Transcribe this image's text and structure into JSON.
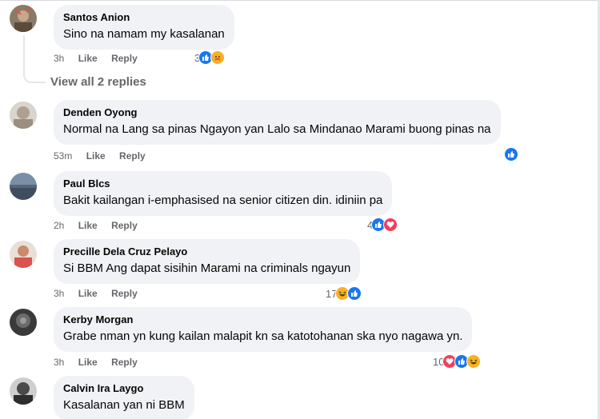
{
  "comments": [
    {
      "name": "Santos Anion",
      "text": "Sino na namam my kasalanan",
      "time": "3h",
      "like": "Like",
      "reply": "Reply",
      "reaction_count": "3",
      "reactions": [
        "like-icon",
        "care-icon"
      ]
    },
    {
      "name": "Denden Oyong",
      "text": "Normal na Lang sa pinas Ngayon yan Lalo sa Mindanao Marami buong pinas na",
      "time": "53m",
      "like": "Like",
      "reply": "Reply",
      "reactions": [
        "like-icon"
      ]
    },
    {
      "name": "Paul Blcs",
      "text": "Bakit kailangan i-emphasised na senior citizen din. idiniin pa",
      "time": "2h",
      "like": "Like",
      "reply": "Reply",
      "reaction_count": "4",
      "reactions": [
        "like-icon",
        "love-icon"
      ]
    },
    {
      "name": "Precille Dela Cruz Pelayo",
      "text": "Si BBM Ang dapat sisihin Marami na criminals ngayun",
      "time": "3h",
      "like": "Like",
      "reply": "Reply",
      "reaction_count": "17",
      "reactions": [
        "haha-icon",
        "like-icon"
      ]
    },
    {
      "name": "Kerby Morgan",
      "text": "Grabe nman yn kung kailan malapit kn sa katotohanan ska nyo nagawa yn.",
      "time": "3h",
      "like": "Like",
      "reply": "Reply",
      "reaction_count": "10",
      "reactions": [
        "love-icon",
        "like-icon",
        "haha-icon"
      ]
    },
    {
      "name": "Calvin Ira Laygo",
      "text": "Kasalanan yan ni BBM"
    }
  ],
  "view_replies": "View all 2 replies",
  "colors": {
    "bubble": "#f0f2f5",
    "like": "#1877f2",
    "love": "#f33e58",
    "haha": "#f7b125",
    "meta": "#65676b"
  }
}
